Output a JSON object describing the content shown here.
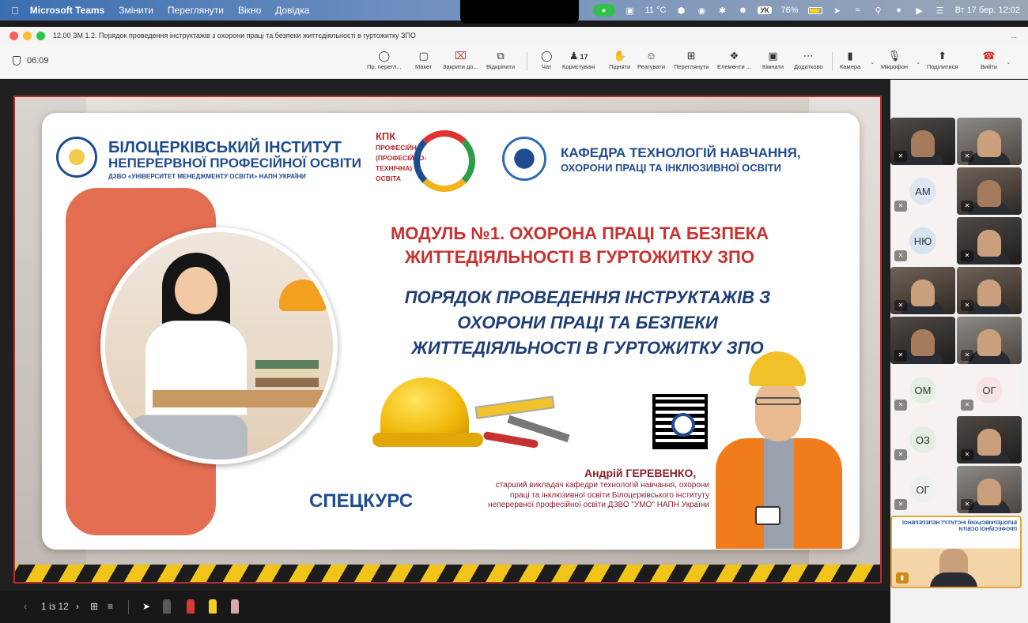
{
  "menubar": {
    "app": "Microsoft Teams",
    "items": [
      "Змінити",
      "Переглянути",
      "Вікно",
      "Довідка"
    ],
    "weather": "11 °C",
    "battery": "76%",
    "keyboard": "УК",
    "datetime": "Вт 17 бер.  12:02"
  },
  "window": {
    "title": "12.00 ЗМ 1.2. Порядок проведення інструктажів з охорони праці та безпеки життєдіяльності в гуртожитку ЗПО",
    "more": "..."
  },
  "toolbar": {
    "timer": "06:09",
    "buttons": [
      {
        "label": "Пр. перегл...",
        "icon": "eye-icon"
      },
      {
        "label": "Макет",
        "icon": "layout-icon"
      },
      {
        "label": "Закрити до...",
        "icon": "close-box-icon"
      },
      {
        "label": "Відкріпити",
        "icon": "unpin-icon"
      },
      {
        "label": "Чат",
        "icon": "chat-icon"
      },
      {
        "label": "Користувачі",
        "icon": "people-icon"
      },
      {
        "label": "Підняти",
        "icon": "hand-icon"
      },
      {
        "label": "Реагувати",
        "icon": "smile-icon"
      },
      {
        "label": "Переглянути",
        "icon": "grid-icon"
      },
      {
        "label": "Елементи ...",
        "icon": "apps-icon"
      },
      {
        "label": "Кімнати",
        "icon": "rooms-icon"
      },
      {
        "label": "Додатково",
        "icon": "more-icon"
      },
      {
        "label": "Камера",
        "icon": "camera-icon"
      },
      {
        "label": "Мікрофон",
        "icon": "mic-icon"
      },
      {
        "label": "Поділитися",
        "icon": "share-icon"
      },
      {
        "label": "Вийти",
        "icon": "leave-icon"
      }
    ],
    "users_count": "17"
  },
  "slide": {
    "institute_line1": "БІЛОЦЕРКІВСЬКИЙ ІНСТИТУТ",
    "institute_line2": "НЕПЕРЕРВНОЇ ПРОФЕСІЙНОЇ ОСВІТИ",
    "institute_sub": "ДЗВО «УНІВЕРСИТЕТ МЕНЕДЖМЕНТУ ОСВІТИ» НАПН УКРАЇНИ",
    "kpk": "КПК",
    "kpk_sub": "ПРОФЕСІЙНА (ПРОФЕСІЙНО-ТЕХНІЧНА) ОСВІТА",
    "dept_line1": "КАФЕДРА ТЕХНОЛОГІЙ НАВЧАННЯ,",
    "dept_line2": "ОХОРОНИ ПРАЦІ ТА ІНКЛЮЗИВНОЇ ОСВІТИ",
    "module": "МОДУЛЬ №1. ОХОРОНА ПРАЦІ ТА БЕЗПЕКА ЖИТТЕДІЯЛЬНОСТІ В ГУРТОЖИТКУ ЗПО",
    "topic": "ПОРЯДОК ПРОВЕДЕННЯ ІНСТРУКТАЖІВ З ОХОРОНИ ПРАЦІ ТА БЕЗПЕКИ ЖИТТЕДІЯЛЬНОСТІ В ГУРТОЖИТКУ ЗПО",
    "speckurs": "СПЕЦКУРС",
    "author": "Андрій ГЕРЕВЕНКО,",
    "author_desc": "старший викладач кафедри технологій навчання, охорони праці та інклюзивної освіти Білоцерківського інституту неперервної професійної освіти ДЗВО \"УМО\" НАПН України"
  },
  "participants": [
    {
      "type": "video"
    },
    {
      "type": "video"
    },
    {
      "type": "initials",
      "initials": "АМ"
    },
    {
      "type": "video"
    },
    {
      "type": "initials",
      "initials": "НЮ"
    },
    {
      "type": "video"
    },
    {
      "type": "video"
    },
    {
      "type": "video"
    },
    {
      "type": "video"
    },
    {
      "type": "video"
    },
    {
      "type": "initials",
      "initials": "ОМ"
    },
    {
      "type": "initials",
      "initials": "ОГ"
    },
    {
      "type": "initials",
      "initials": "ОЗ"
    },
    {
      "type": "video"
    },
    {
      "type": "initials",
      "initials": "ОГ"
    },
    {
      "type": "video"
    }
  ],
  "presenter_tile_text": "БІЛОЦЕРКІВСЬКИЙ ІНСТИТУТ НЕПЕРЕРВНОЇ ПРОФЕСІЙНОЇ ОСВІТИ",
  "bottombar": {
    "page": "1 із 12",
    "prev": "‹",
    "next": "›"
  },
  "colors": {
    "accent_red": "#c8312f",
    "brand_blue": "#1f4c8f",
    "leave_red": "#d9261c"
  }
}
